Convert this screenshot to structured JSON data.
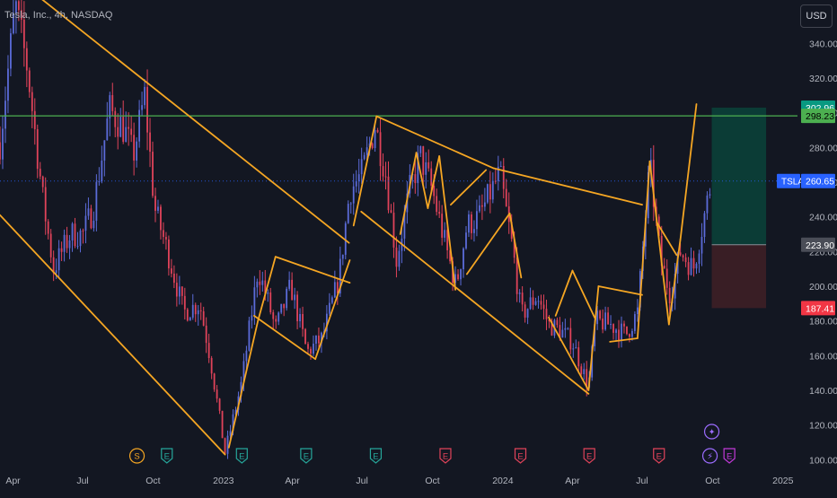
{
  "header": {
    "title": "Tesla, Inc., 4h, NASDAQ",
    "currency": "USD"
  },
  "colors": {
    "background": "#131722",
    "up_candle": "#5b6bd8",
    "down_candle": "#e0435a",
    "trendline": "#f5a623",
    "resistance_line": "#4caf50",
    "profit_zone": "#0b4038",
    "loss_zone": "#3e1f26",
    "axis_text": "#b2b5be"
  },
  "chart_data": {
    "type": "candlestick",
    "symbol": "TSLA",
    "interval": "4h",
    "y_axis": {
      "ticks": [
        100,
        120,
        140,
        160,
        180,
        200,
        220,
        240,
        260,
        280,
        300,
        320,
        340
      ],
      "tick_labels": [
        "100.00",
        "120.00",
        "140.00",
        "160.00",
        "180.00",
        "200.00",
        "220.00",
        "240.00",
        "260.00",
        "280.00",
        "300.00",
        "320.00",
        "340.00"
      ],
      "range": [
        95,
        365
      ]
    },
    "x_axis": {
      "range": [
        "2022-03-15",
        "2025-01-20"
      ],
      "ticks": [
        {
          "date": "2022-04-01",
          "label": "Apr"
        },
        {
          "date": "2022-07-01",
          "label": "Jul"
        },
        {
          "date": "2022-10-01",
          "label": "Oct"
        },
        {
          "date": "2023-01-01",
          "label": "2023"
        },
        {
          "date": "2023-04-01",
          "label": "Apr"
        },
        {
          "date": "2023-07-01",
          "label": "Jul"
        },
        {
          "date": "2023-10-01",
          "label": "Oct"
        },
        {
          "date": "2024-01-01",
          "label": "2024"
        },
        {
          "date": "2024-04-01",
          "label": "Apr"
        },
        {
          "date": "2024-07-01",
          "label": "Jul"
        },
        {
          "date": "2024-10-01",
          "label": "Oct"
        },
        {
          "date": "2025-01-01",
          "label": "2025"
        }
      ]
    },
    "price_path": [
      [
        "2022-03-15",
        283
      ],
      [
        "2022-04-04",
        362
      ],
      [
        "2022-04-20",
        325
      ],
      [
        "2022-05-10",
        250
      ],
      [
        "2022-05-24",
        210
      ],
      [
        "2022-06-15",
        230
      ],
      [
        "2022-07-01",
        230
      ],
      [
        "2022-07-15",
        245
      ],
      [
        "2022-08-05",
        302
      ],
      [
        "2022-08-25",
        290
      ],
      [
        "2022-09-05",
        275
      ],
      [
        "2022-09-20",
        310
      ],
      [
        "2022-10-03",
        245
      ],
      [
        "2022-10-20",
        220
      ],
      [
        "2022-11-10",
        185
      ],
      [
        "2022-12-01",
        190
      ],
      [
        "2022-12-15",
        158
      ],
      [
        "2023-01-03",
        104
      ],
      [
        "2023-01-25",
        145
      ],
      [
        "2023-02-15",
        210
      ],
      [
        "2023-03-01",
        190
      ],
      [
        "2023-03-10",
        175
      ],
      [
        "2023-03-30",
        200
      ],
      [
        "2023-04-20",
        162
      ],
      [
        "2023-05-10",
        170
      ],
      [
        "2023-06-01",
        205
      ],
      [
        "2023-06-15",
        255
      ],
      [
        "2023-07-01",
        265
      ],
      [
        "2023-07-18",
        293
      ],
      [
        "2023-08-01",
        265
      ],
      [
        "2023-08-15",
        215
      ],
      [
        "2023-09-01",
        255
      ],
      [
        "2023-09-15",
        275
      ],
      [
        "2023-10-01",
        255
      ],
      [
        "2023-10-20",
        220
      ],
      [
        "2023-11-01",
        200
      ],
      [
        "2023-11-15",
        235
      ],
      [
        "2023-12-01",
        240
      ],
      [
        "2023-12-28",
        265
      ],
      [
        "2024-01-15",
        218
      ],
      [
        "2024-01-25",
        183
      ],
      [
        "2024-02-15",
        195
      ],
      [
        "2024-03-01",
        178
      ],
      [
        "2024-03-15",
        175
      ],
      [
        "2024-04-01",
        168
      ],
      [
        "2024-04-22",
        142
      ],
      [
        "2024-05-01",
        180
      ],
      [
        "2024-05-20",
        178
      ],
      [
        "2024-06-10",
        172
      ],
      [
        "2024-06-25",
        185
      ],
      [
        "2024-07-11",
        270
      ],
      [
        "2024-07-25",
        215
      ],
      [
        "2024-08-07",
        195
      ],
      [
        "2024-08-20",
        220
      ],
      [
        "2024-09-06",
        210
      ],
      [
        "2024-09-20",
        240
      ],
      [
        "2024-09-30",
        262
      ]
    ],
    "trendlines": [
      {
        "from": [
          "2022-04-20",
          372
        ],
        "to": [
          "2023-06-14",
          225
        ]
      },
      {
        "from": [
          "2022-03-15",
          241
        ],
        "to": [
          "2023-01-03",
          103
        ]
      },
      {
        "from": [
          "2023-01-08",
          107
        ],
        "to": [
          "2023-02-15",
          180
        ]
      },
      {
        "from": [
          "2023-02-15",
          180
        ],
        "to": [
          "2023-03-10",
          217
        ]
      },
      {
        "from": [
          "2023-03-10",
          217
        ],
        "to": [
          "2023-06-15",
          202
        ]
      },
      {
        "from": [
          "2023-02-10",
          183
        ],
        "to": [
          "2023-05-01",
          158
        ]
      },
      {
        "from": [
          "2023-05-01",
          158
        ],
        "to": [
          "2023-06-15",
          215
        ]
      },
      {
        "from": [
          "2023-06-20",
          235
        ],
        "to": [
          "2023-07-20",
          298
        ]
      },
      {
        "from": [
          "2023-07-20",
          298
        ],
        "to": [
          "2023-12-20",
          268
        ]
      },
      {
        "from": [
          "2023-12-20",
          268
        ],
        "to": [
          "2024-07-01",
          247
        ]
      },
      {
        "from": [
          "2023-06-30",
          243
        ],
        "to": [
          "2024-04-22",
          138
        ]
      },
      {
        "from": [
          "2023-08-20",
          230
        ],
        "to": [
          "2023-09-10",
          277
        ]
      },
      {
        "from": [
          "2023-09-10",
          277
        ],
        "to": [
          "2023-09-25",
          245
        ]
      },
      {
        "from": [
          "2023-09-25",
          245
        ],
        "to": [
          "2023-10-10",
          275
        ]
      },
      {
        "from": [
          "2023-10-10",
          275
        ],
        "to": [
          "2023-10-31",
          198
        ]
      },
      {
        "from": [
          "2023-10-25",
          247
        ],
        "to": [
          "2023-12-10",
          267
        ]
      },
      {
        "from": [
          "2023-11-15",
          207
        ],
        "to": [
          "2024-01-10",
          242
        ]
      },
      {
        "from": [
          "2024-01-10",
          242
        ],
        "to": [
          "2024-01-25",
          205
        ]
      },
      {
        "from": [
          "2024-03-10",
          183
        ],
        "to": [
          "2024-04-01",
          209
        ]
      },
      {
        "from": [
          "2024-04-01",
          209
        ],
        "to": [
          "2024-05-01",
          181
        ]
      },
      {
        "from": [
          "2024-03-01",
          182
        ],
        "to": [
          "2024-04-22",
          140
        ]
      },
      {
        "from": [
          "2024-04-22",
          140
        ],
        "to": [
          "2024-05-05",
          200
        ]
      },
      {
        "from": [
          "2024-05-05",
          200
        ],
        "to": [
          "2024-07-01",
          195
        ]
      },
      {
        "from": [
          "2024-05-20",
          168
        ],
        "to": [
          "2024-06-25",
          170
        ]
      },
      {
        "from": [
          "2024-06-25",
          170
        ],
        "to": [
          "2024-07-11",
          272
        ]
      },
      {
        "from": [
          "2024-07-11",
          272
        ],
        "to": [
          "2024-08-05",
          178
        ]
      },
      {
        "from": [
          "2024-07-20",
          237
        ],
        "to": [
          "2024-08-15",
          218
        ]
      },
      {
        "from": [
          "2024-08-05",
          178
        ],
        "to": [
          "2024-08-20",
          227
        ]
      },
      {
        "from": [
          "2024-08-20",
          227
        ],
        "to": [
          "2024-09-10",
          305
        ]
      }
    ],
    "horizontal_lines": [
      {
        "price": 298.23,
        "label": "298.23"
      }
    ],
    "current_price": {
      "symbol": "TSLA",
      "price": 260.65,
      "label": "260.65"
    },
    "position": {
      "start": "2024-09-30",
      "end": "2024-12-10",
      "target": 302.96,
      "entry": 223.9,
      "stop": 187.41,
      "target_label": "302.96",
      "entry_label": "223.90",
      "stop_label": "187.41"
    },
    "event_markers": [
      {
        "date": "2022-09-10",
        "glyph": "S",
        "kind": "split",
        "color": "#f5a623",
        "row": 0
      },
      {
        "date": "2022-10-19",
        "glyph": "E",
        "kind": "earnings",
        "color": "#26a69a",
        "row": 0
      },
      {
        "date": "2023-01-25",
        "glyph": "E",
        "kind": "earnings",
        "color": "#26a69a",
        "row": 0
      },
      {
        "date": "2023-04-19",
        "glyph": "E",
        "kind": "earnings",
        "color": "#26a69a",
        "row": 0
      },
      {
        "date": "2023-07-19",
        "glyph": "E",
        "kind": "earnings",
        "color": "#26a69a",
        "row": 0
      },
      {
        "date": "2023-10-18",
        "glyph": "E",
        "kind": "earnings",
        "color": "#e0435a",
        "row": 0
      },
      {
        "date": "2024-01-24",
        "glyph": "E",
        "kind": "earnings",
        "color": "#e0435a",
        "row": 0
      },
      {
        "date": "2024-04-23",
        "glyph": "E",
        "kind": "earnings",
        "color": "#e0435a",
        "row": 0
      },
      {
        "date": "2024-07-23",
        "glyph": "E",
        "kind": "earnings",
        "color": "#e0435a",
        "row": 0
      },
      {
        "date": "2024-09-30",
        "glyph": "✦",
        "kind": "event",
        "color": "#9c6cff",
        "row": 1
      },
      {
        "date": "2024-09-30",
        "glyph": "⚡",
        "kind": "event",
        "color": "#9c6cff",
        "row": 0
      },
      {
        "date": "2024-10-23",
        "glyph": "E",
        "kind": "earnings",
        "color": "#c239d8",
        "row": 0
      }
    ]
  }
}
